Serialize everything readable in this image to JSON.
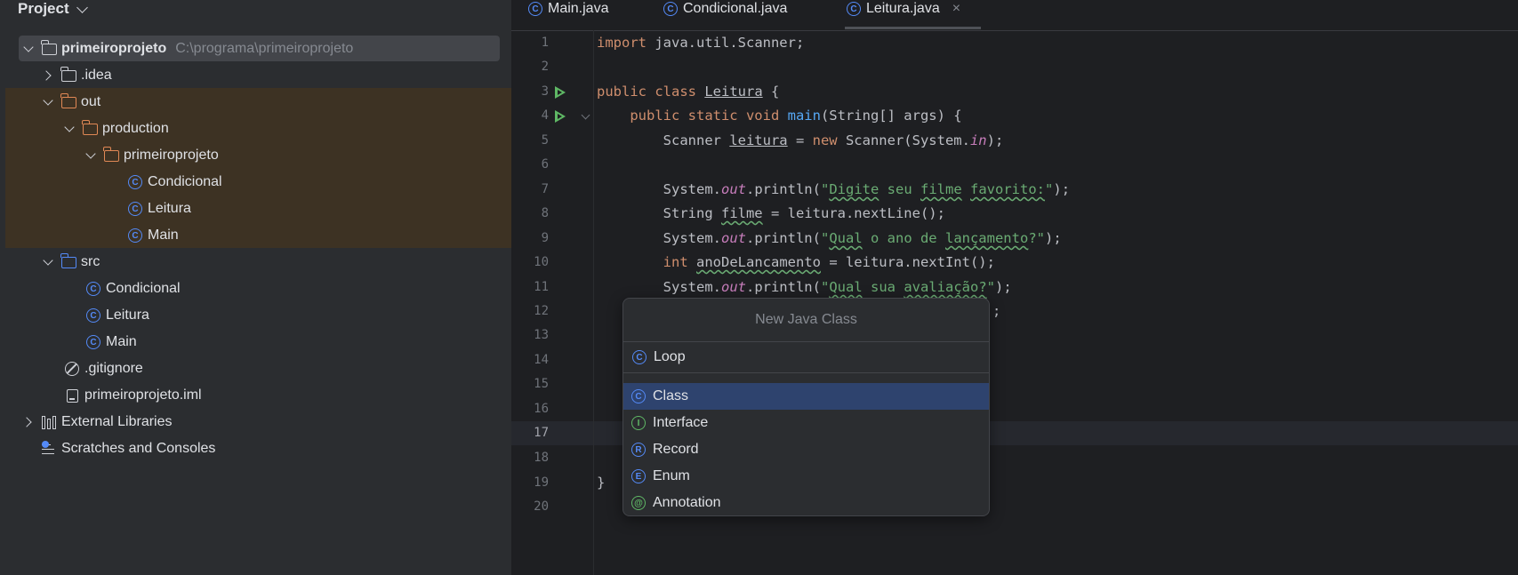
{
  "project_panel": {
    "title": "Project",
    "tree": [
      {
        "label": "primeiroprojeto",
        "path": "C:\\programa\\primeiroprojeto",
        "kind": "module",
        "expanded": true
      },
      {
        "label": ".idea",
        "kind": "folder",
        "expanded": false
      },
      {
        "label": "out",
        "kind": "folder-excluded",
        "expanded": true
      },
      {
        "label": "production",
        "kind": "folder-excluded",
        "expanded": true
      },
      {
        "label": "primeiroprojeto",
        "kind": "folder-excluded",
        "expanded": true
      },
      {
        "label": "Condicional",
        "kind": "class"
      },
      {
        "label": "Leitura",
        "kind": "class"
      },
      {
        "label": "Main",
        "kind": "class"
      },
      {
        "label": "src",
        "kind": "source-folder",
        "expanded": true
      },
      {
        "label": "Condicional",
        "kind": "class"
      },
      {
        "label": "Leitura",
        "kind": "class"
      },
      {
        "label": "Main",
        "kind": "class"
      },
      {
        "label": ".gitignore",
        "kind": "ignore-file"
      },
      {
        "label": "primeiroprojeto.iml",
        "kind": "iml-file"
      },
      {
        "label": "External Libraries",
        "kind": "libraries",
        "expanded": false
      },
      {
        "label": "Scratches and Consoles",
        "kind": "scratches"
      }
    ]
  },
  "tabs": [
    {
      "label": "Main.java",
      "icon": "class-icon",
      "active": false
    },
    {
      "label": "Condicional.java",
      "icon": "class-icon",
      "active": false
    },
    {
      "label": "Leitura.java",
      "icon": "class-icon",
      "active": true,
      "close": "×"
    }
  ],
  "editor": {
    "current_line": 17,
    "line_numbers": [
      "1",
      "2",
      "3",
      "4",
      "5",
      "6",
      "7",
      "8",
      "9",
      "10",
      "11",
      "12",
      "13",
      "14",
      "15",
      "16",
      "17",
      "18",
      "19",
      "20"
    ],
    "code": {
      "l1_kw": "import",
      "l1_rest": " java.util.Scanner;",
      "l3_kw": "public class ",
      "l3_name": "Leitura",
      "l3_rest": " {",
      "l4_indent": "    ",
      "l4_kw": "public static void ",
      "l4_fn": "main",
      "l4_rest": "(String[] args) {",
      "l5_a": "        Scanner ",
      "l5_var": "leitura",
      "l5_b": " = ",
      "l5_kw": "new",
      "l5_c": " Scanner(System.",
      "l5_fld": "in",
      "l5_d": ");",
      "l7_a": "        System.",
      "l7_fld": "out",
      "l7_b": ".println(",
      "l7_q1": "\"",
      "l7_w1": "Digite",
      "l7_s1": " seu ",
      "l7_w2": "filme",
      "l7_s2": " ",
      "l7_w3": "favorito:",
      "l7_q2": "\"",
      "l7_c": ");",
      "l8_a": "        String ",
      "l8_var": "filme",
      "l8_b": " = leitura.nextLine();",
      "l9_a": "        System.",
      "l9_fld": "out",
      "l9_b": ".println(",
      "l9_q1": "\"",
      "l9_w1": "Qual",
      "l9_s1": " o ano de ",
      "l9_w2": "lançamento",
      "l9_s2": "?\"",
      "l9_c": ");",
      "l10_indent": "        ",
      "l10_kw": "int",
      "l10_a": " ",
      "l10_var": "anoDeLancamento",
      "l10_b": " = leitura.nextInt();",
      "l11_a": "        System.",
      "l11_fld": "out",
      "l11_b": ".println(",
      "l11_q1": "\"",
      "l11_w1": "Qual",
      "l11_s1": " sua ",
      "l11_w2": "avaliação?",
      "l11_q2": "\"",
      "l11_c": ");",
      "l12_visible": "e();",
      "l19": "}"
    }
  },
  "popup": {
    "title": "New Java Class",
    "input_value": "Loop",
    "options": [
      {
        "label": "Class",
        "icon": "class-icon",
        "letter": "C",
        "selected": true
      },
      {
        "label": "Interface",
        "icon": "interface-icon",
        "letter": "I",
        "selected": false
      },
      {
        "label": "Record",
        "icon": "record-icon",
        "letter": "R",
        "selected": false
      },
      {
        "label": "Enum",
        "icon": "enum-icon",
        "letter": "E",
        "selected": false
      },
      {
        "label": "Annotation",
        "icon": "annotation-icon",
        "letter": "@",
        "selected": false
      }
    ]
  },
  "colors": {
    "panel_bg": "#2b2d30",
    "editor_bg": "#1e1f22",
    "excluded_bg": "#3d3223",
    "keyword": "#cf8e6d",
    "string": "#6aab73",
    "function": "#56a8f5",
    "field": "#c77dbb",
    "selection": "#2e436e",
    "accent_blue": "#548af7"
  }
}
